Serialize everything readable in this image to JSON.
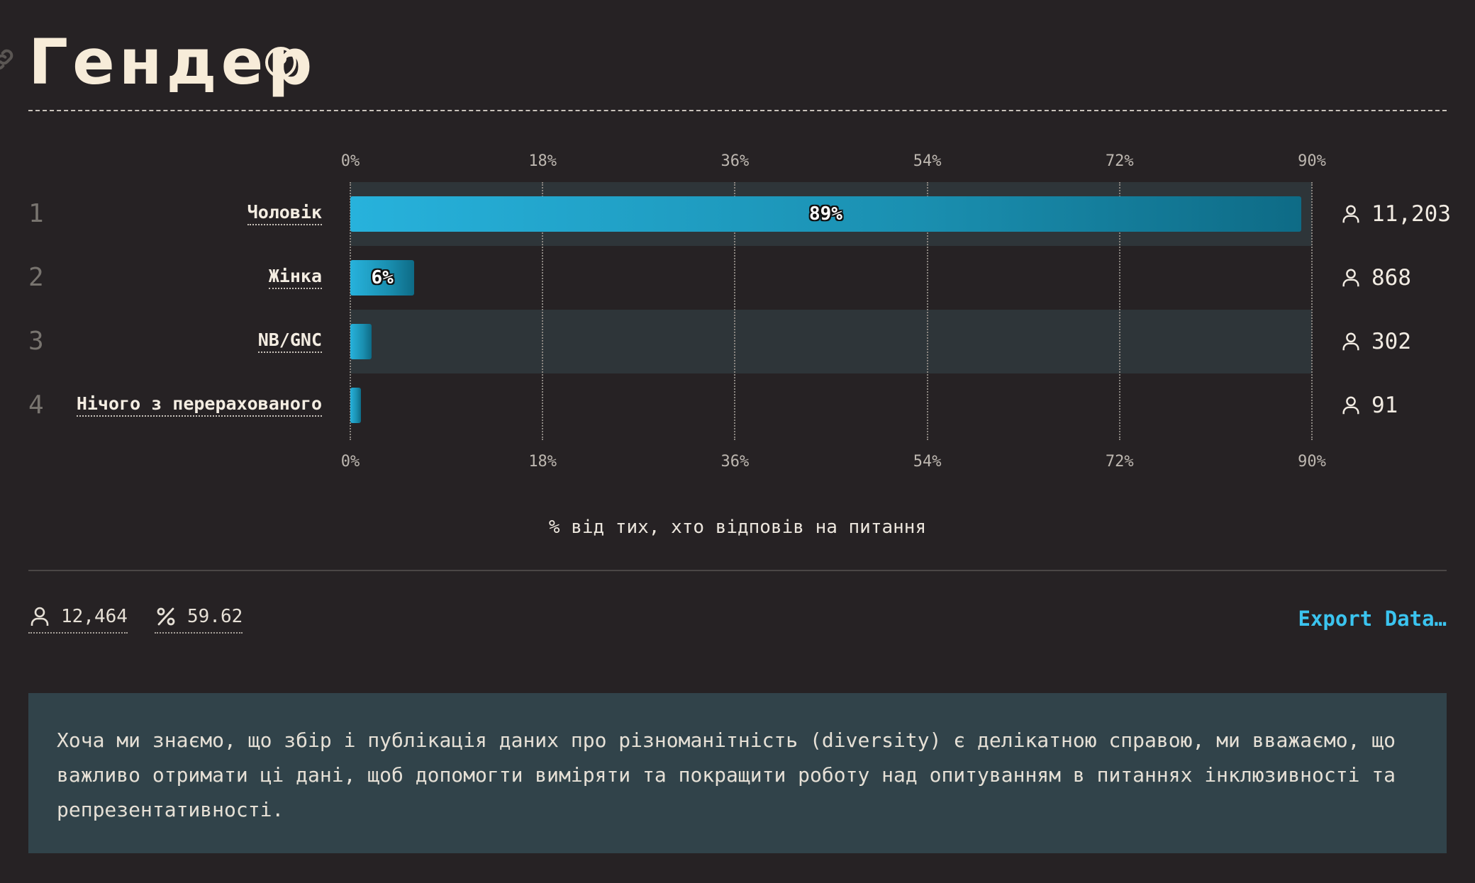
{
  "page": {
    "title": "Гендер"
  },
  "chart_data": {
    "type": "bar",
    "orientation": "horizontal",
    "categories": [
      "Чоловік",
      "Жінка",
      "NB/GNC",
      "Нічого з перерахованого"
    ],
    "ranks": [
      "1",
      "2",
      "3",
      "4"
    ],
    "values": [
      89,
      6,
      2,
      1
    ],
    "bar_labels": [
      "89%",
      "6%",
      "",
      ""
    ],
    "counts": [
      "11,203",
      "868",
      "302",
      "91"
    ],
    "xlim": [
      0,
      90
    ],
    "x_ticks": [
      "0%",
      "18%",
      "36%",
      "54%",
      "72%",
      "90%"
    ],
    "xlabel": "% від тих, хто відповів на питання",
    "colors": {
      "bar_start": "#27b2dc",
      "bar_end": "#0e6b86",
      "row_shade": "#2e3539"
    }
  },
  "stats": {
    "respondents": "12,464",
    "percent": "59.62"
  },
  "export_label": "Export Data…",
  "note_text": "Хоча ми знаємо, що збір і публікація даних про різноманітність (diversity) є делікатною справою, ми вважаємо, що важливо отримати ці дані, щоб допомогти виміряти та покращити роботу над опитуванням в питаннях інклюзивності та репрезентативності.",
  "icons": {
    "link": "link-icon",
    "help": "help-circle-icon",
    "user": "user-icon",
    "percent": "percent-icon"
  },
  "accent_color": "#3bc4ef"
}
